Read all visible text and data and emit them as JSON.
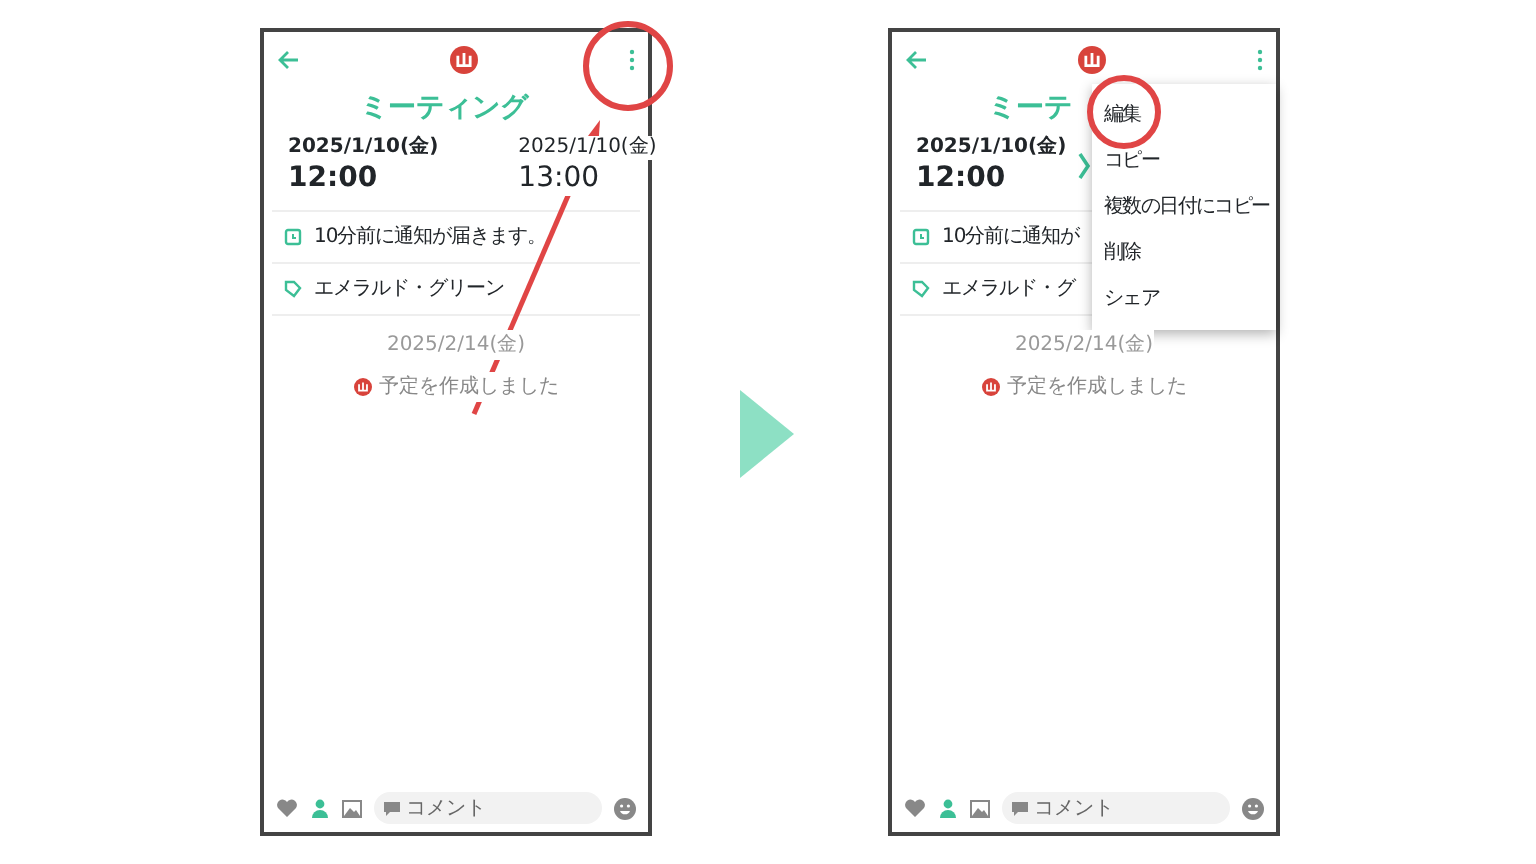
{
  "screens": [
    {
      "title": "ミーティング",
      "start_date": "2025/1/10(金)",
      "start_time": "12:00",
      "end_date": "2025/1/10(金)",
      "end_time": "13:00",
      "reminder": "10分前に通知が届きます。",
      "tag": "エメラルド・グリーン",
      "history_date": "2025/2/14(金)",
      "history_text": "予定を作成しました",
      "comment_placeholder": "コメント"
    },
    {
      "title": "ミーテ",
      "start_date": "2025/1/10(金)",
      "start_time": "12:00",
      "reminder": "10分前に通知が",
      "tag": "エメラルド・グ",
      "history_date": "2025/2/14(金)",
      "history_text": "予定を作成しました",
      "comment_placeholder": "コメント",
      "menu": [
        {
          "label": "編集"
        },
        {
          "label": "コピー"
        },
        {
          "label": "複数の日付にコピー"
        },
        {
          "label": "削除"
        },
        {
          "label": "シェア"
        }
      ]
    }
  ]
}
